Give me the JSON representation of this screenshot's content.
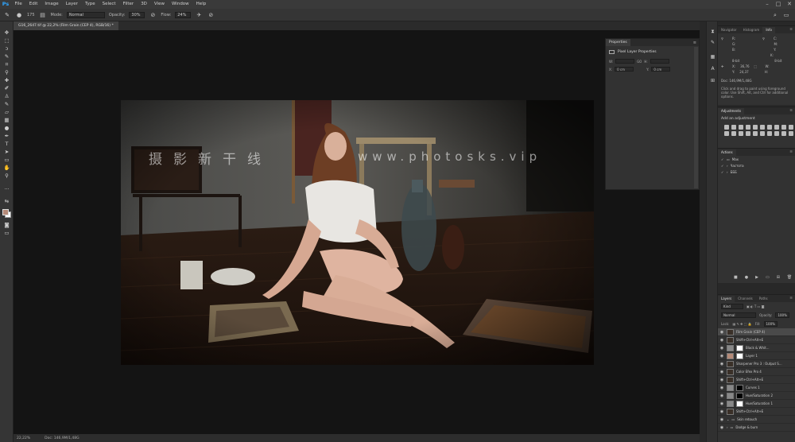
{
  "app": {
    "logo": "Ps"
  },
  "menu": [
    "File",
    "Edit",
    "Image",
    "Layer",
    "Type",
    "Select",
    "Filter",
    "3D",
    "View",
    "Window",
    "Help"
  ],
  "window_controls": [
    "–",
    "□",
    "✕"
  ],
  "options_bar": {
    "brush_size": "175",
    "mode_label": "Mode:",
    "mode_value": "Normal",
    "opacity_label": "Opacity:",
    "opacity_value": "30%",
    "flow_label": "Flow:",
    "flow_value": "24%"
  },
  "document_tab": "G16_2647.tif @ 22,2% (Film Grain (CEP 4), RGB/16) *",
  "canvas": {
    "watermark_cn": "摄影新干线",
    "watermark_url": "www.photosks.vip"
  },
  "status_bar": {
    "zoom": "22,22%",
    "doc": "Doc: 146,9M/1,48G"
  },
  "properties_panel": {
    "tab": "Properties",
    "title": "Pixel Layer Properties",
    "w_label": "W:",
    "w_value": "",
    "h_label": "H:",
    "h_value": "",
    "link_label": "GO",
    "x_label": "X:",
    "x_value": "0 cm",
    "y_label": "Y:",
    "y_value": "0 cm"
  },
  "nav_panel": {
    "tabs": [
      "Navigator",
      "Histogram",
      "Info"
    ],
    "info": {
      "r_label": "R:",
      "c_label": "C:",
      "g_label": "G:",
      "m_label": "M:",
      "b_label": "B:",
      "y_label": "Y:",
      "k_label": "K:",
      "bit_left": "8-bit",
      "bit_right": "8-bit",
      "x_label": "X:",
      "x_value": "36,76",
      "y_value": "24,37",
      "w_label": "W:",
      "h_label": "H:",
      "doc": "Doc: 146,9M/1,48G",
      "hint": "Click and drag to paint using foreground color. Use Shift, Alt, and Ctrl for additional options."
    }
  },
  "adjustments_panel": {
    "title": "Adjustments",
    "subtitle": "Add an adjustment"
  },
  "actions_panel": {
    "title": "Actions",
    "items": [
      "Max",
      "Частота",
      "БББ"
    ]
  },
  "layers_panel": {
    "tabs": [
      "Layers",
      "Channels",
      "Paths"
    ],
    "kind": "Kind",
    "blend": "Normal",
    "opacity_label": "Opacity:",
    "opacity_value": "100%",
    "lock_label": "Lock:",
    "fill_label": "Fill:",
    "fill_value": "100%",
    "layers": [
      "Film Grain (CEP 4)",
      "Shift+Ctrl+Alt+E",
      "Black & Whit...",
      "Layer 1",
      "Sharpener Pro 3 : Output S...",
      "Color Efex Pro 4",
      "Shift+Ctrl+Alt+E",
      "Curves 1",
      "Hue/Saturation 2",
      "Hue/Saturation 1",
      "Shift+Ctrl+Alt+E",
      "Skin retouch",
      "Dodge & burn"
    ]
  },
  "colors": {
    "foreground": "#b58a78",
    "background": "#ffffff",
    "ps_blue": "#2fa6ff"
  }
}
